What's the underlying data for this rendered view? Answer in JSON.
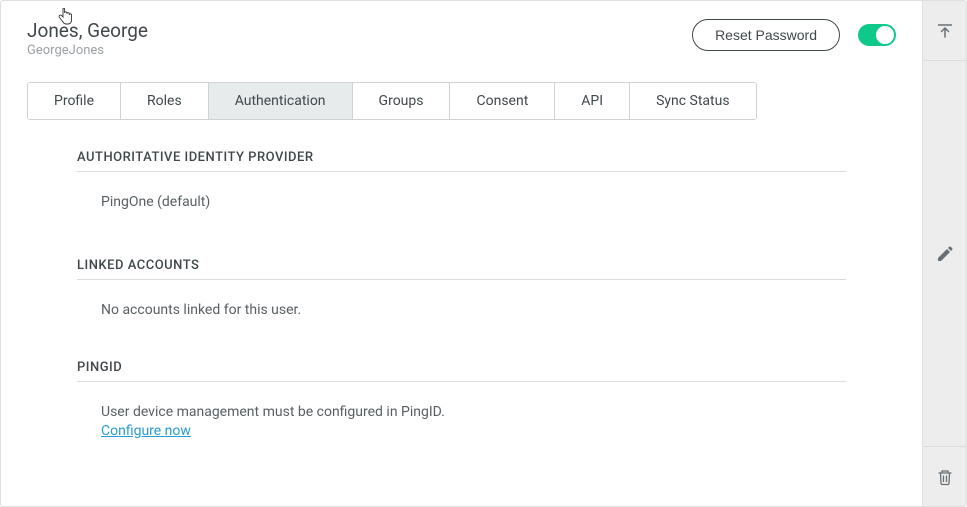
{
  "header": {
    "user_name": "Jones, George",
    "username": "GeorgeJones",
    "reset_button": "Reset Password"
  },
  "tabs": [
    {
      "label": "Profile"
    },
    {
      "label": "Roles"
    },
    {
      "label": "Authentication"
    },
    {
      "label": "Groups"
    },
    {
      "label": "Consent"
    },
    {
      "label": "API"
    },
    {
      "label": "Sync Status"
    }
  ],
  "active_tab_index": 2,
  "sections": {
    "idp": {
      "title": "AUTHORITATIVE IDENTITY PROVIDER",
      "value": "PingOne (default)"
    },
    "linked": {
      "title": "LINKED ACCOUNTS",
      "value": "No accounts linked for this user."
    },
    "pingid": {
      "title": "PINGID",
      "message": "User device management must be configured in PingID.",
      "link_text": "Configure now"
    }
  },
  "toggle_on": true
}
